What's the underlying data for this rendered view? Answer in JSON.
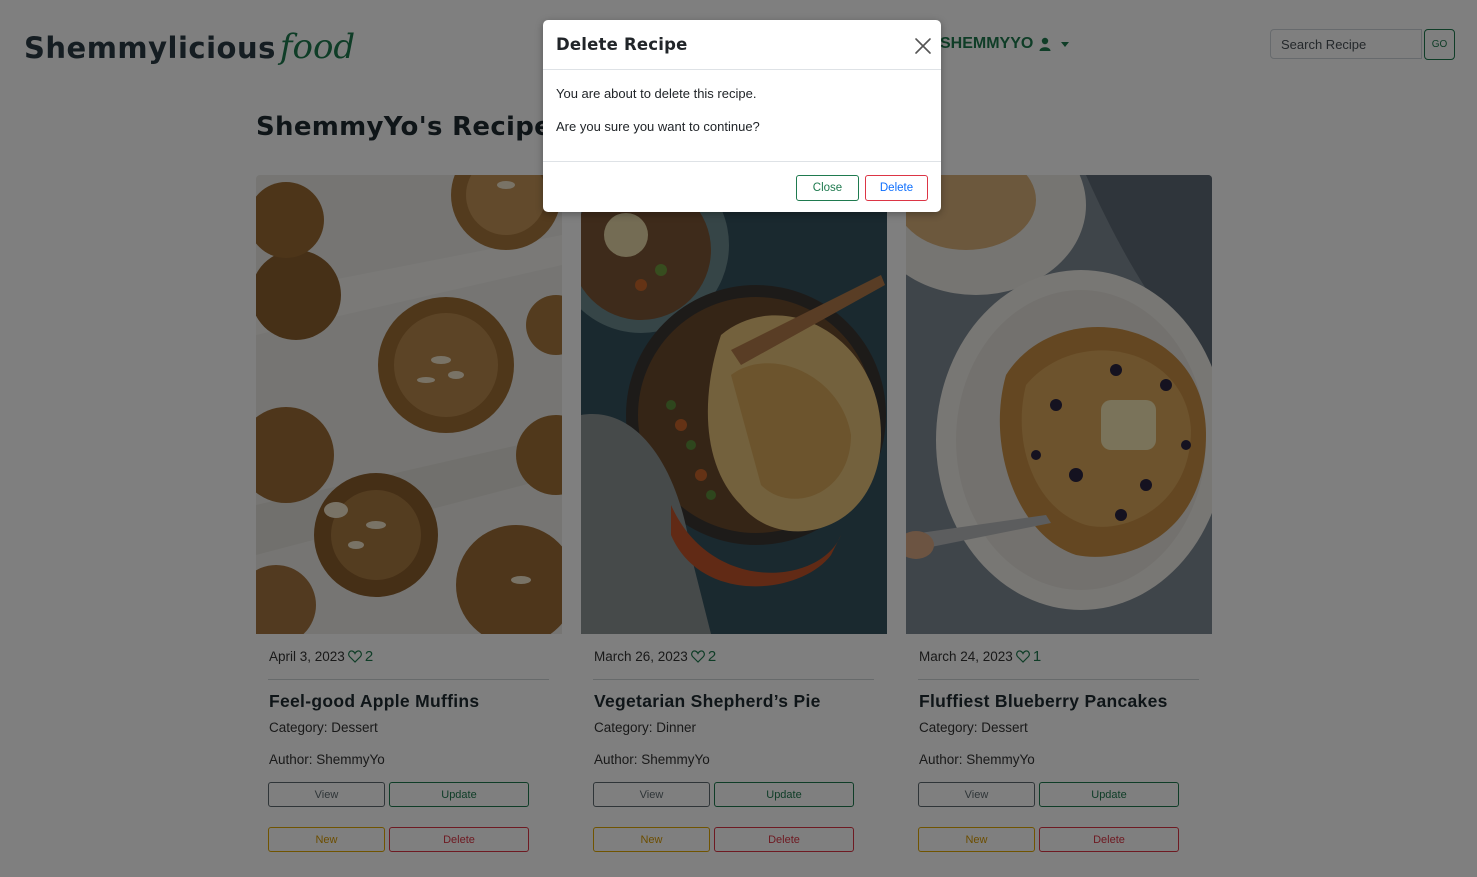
{
  "brand": {
    "main": "Shemmylicious",
    "script": "food"
  },
  "header": {
    "user_label": "SHEMMYYO",
    "search_placeholder": "Search Recipe",
    "search_button": "GO"
  },
  "page": {
    "title": "ShemmyYo's Recipes Page"
  },
  "cards": [
    {
      "date": "April 3, 2023",
      "likes": "2",
      "title": "Feel-good Apple Muffins",
      "category": "Category: Dessert",
      "author": "Author: ShemmyYo",
      "image": "muffins-photo"
    },
    {
      "date": "March 26, 2023",
      "likes": "2",
      "title": "Vegetarian Shepherd’s Pie",
      "category": "Category: Dinner",
      "author": "Author: ShemmyYo",
      "image": "shepherds-pie-photo"
    },
    {
      "date": "March 24, 2023",
      "likes": "1",
      "title": "Fluffiest Blueberry Pancakes",
      "category": "Category: Dessert",
      "author": "Author: ShemmyYo",
      "image": "pancakes-photo"
    }
  ],
  "card_buttons": {
    "view": "View",
    "update": "Update",
    "new": "New",
    "delete": "Delete"
  },
  "modal": {
    "title": "Delete Recipe",
    "line1": "You are about to delete this recipe.",
    "line2": "Are you sure you want to continue?",
    "close_label": "Close",
    "delete_label": "Delete"
  },
  "colors": {
    "brand_green": "#1f7a4f",
    "danger": "#dc3545",
    "warning": "#e0a800",
    "secondary": "#5f6b70",
    "link_blue": "#0d6efd"
  },
  "icons": [
    "user-icon",
    "caret-down-icon",
    "heart-icon",
    "close-icon"
  ]
}
